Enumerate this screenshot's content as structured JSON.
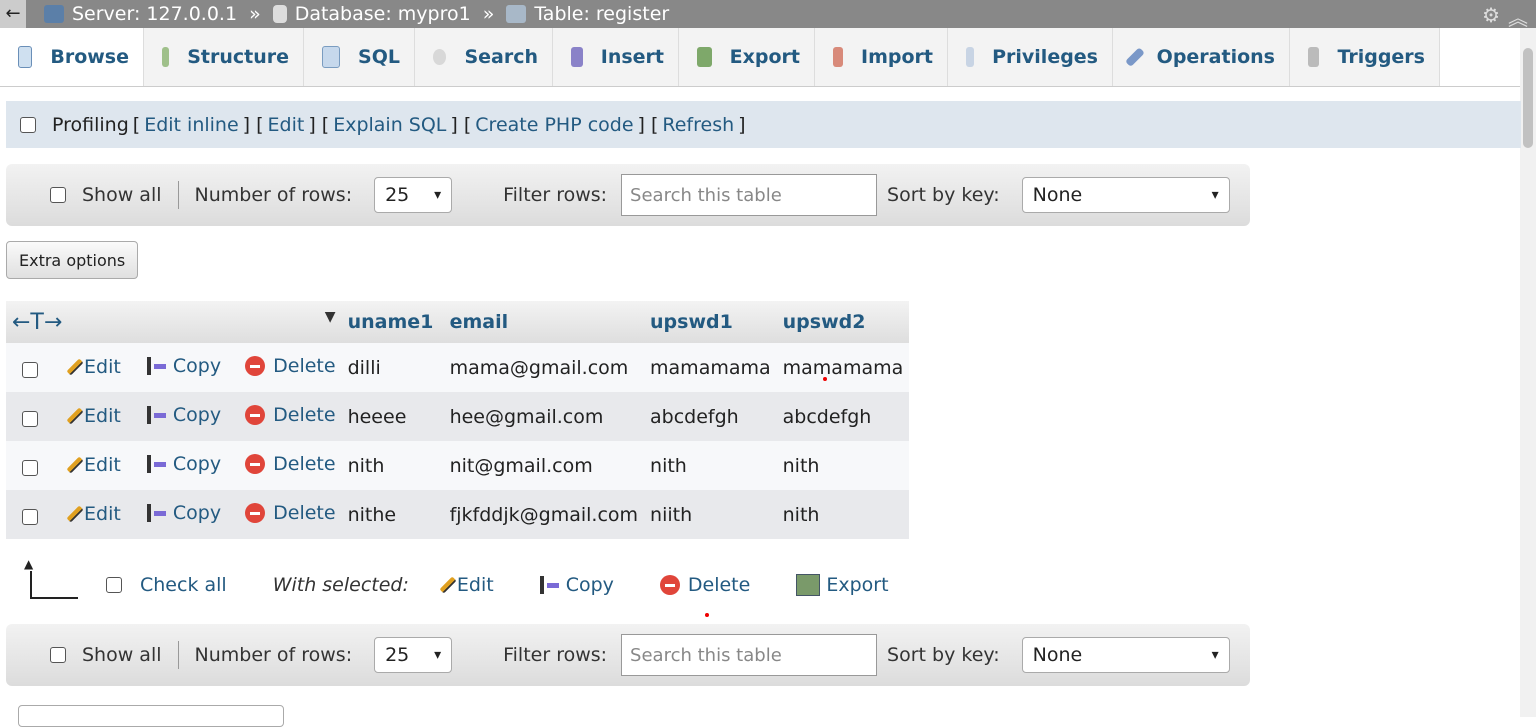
{
  "breadcrumb": {
    "back_label": "←",
    "server": "Server: 127.0.0.1",
    "database": "Database: mypro1",
    "table": "Table: register",
    "separator": "»"
  },
  "tabs": [
    {
      "label": "Browse",
      "icon": "browse-icon"
    },
    {
      "label": "Structure",
      "icon": "structure-icon"
    },
    {
      "label": "SQL",
      "icon": "sql-icon"
    },
    {
      "label": "Search",
      "icon": "search-icon"
    },
    {
      "label": "Insert",
      "icon": "insert-icon"
    },
    {
      "label": "Export",
      "icon": "export-icon"
    },
    {
      "label": "Import",
      "icon": "import-icon"
    },
    {
      "label": "Privileges",
      "icon": "privileges-icon"
    },
    {
      "label": "Operations",
      "icon": "operations-icon"
    },
    {
      "label": "Triggers",
      "icon": "triggers-icon"
    }
  ],
  "profiling": {
    "label": "Profiling",
    "links": [
      "Edit inline",
      "Edit",
      "Explain SQL",
      "Create PHP code",
      "Refresh"
    ]
  },
  "navbar": {
    "show_all": "Show all",
    "rows_label": "Number of rows:",
    "rows_value": "25",
    "filter_label": "Filter rows:",
    "filter_placeholder": "Search this table",
    "sort_label": "Sort by key:",
    "sort_value": "None"
  },
  "extra_options": "Extra options",
  "table": {
    "columns": [
      "uname1",
      "email",
      "upswd1",
      "upswd2"
    ],
    "actions": {
      "edit": "Edit",
      "copy": "Copy",
      "delete": "Delete"
    },
    "rows": [
      [
        "dilli",
        "mama@gmail.com",
        "mamamama",
        "mamamama"
      ],
      [
        "heeee",
        "hee@gmail.com",
        "abcdefgh",
        "abcdefgh"
      ],
      [
        "nith",
        "nit@gmail.com",
        "nith",
        "nith"
      ],
      [
        "nithe",
        "fjkfddjk@gmail.com",
        "niith",
        "nith"
      ]
    ]
  },
  "with_selected": {
    "check_all": "Check all",
    "label": "With selected:",
    "edit": "Edit",
    "copy": "Copy",
    "delete": "Delete",
    "export": "Export"
  },
  "colors": {
    "link": "#235a81",
    "profiling_bg": "#dee6ee",
    "topbar_bg": "#888888"
  }
}
